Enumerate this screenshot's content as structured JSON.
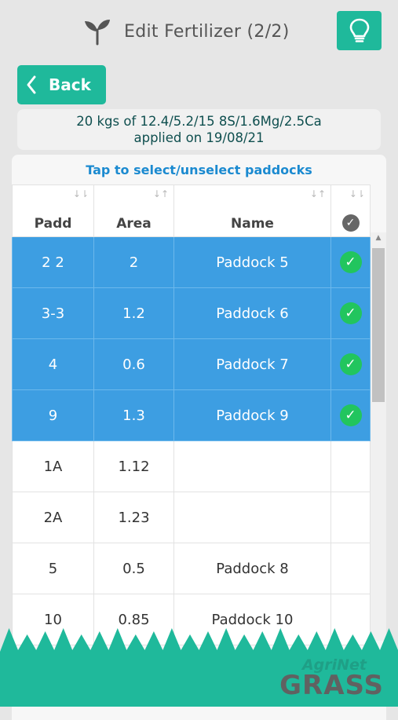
{
  "header": {
    "title": "Edit Fertilizer (2/2)",
    "icon": "sprout-icon",
    "action_icon": "lightbulb-icon"
  },
  "back": {
    "label": "Back"
  },
  "info": {
    "line1": "20 kgs of 12.4/5.2/15 8S/1.6Mg/2.5Ca",
    "line2": "applied on 19/08/21"
  },
  "instruction": "Tap to select/unselect paddocks",
  "table": {
    "headers": {
      "padd": "Padd",
      "area": "Area",
      "name": "Name"
    },
    "rows": [
      {
        "padd": "2 2",
        "area": "2",
        "name": "Paddock 5",
        "selected": true
      },
      {
        "padd": "3-3",
        "area": "1.2",
        "name": "Paddock 6",
        "selected": true
      },
      {
        "padd": "4",
        "area": "0.6",
        "name": "Paddock 7",
        "selected": true
      },
      {
        "padd": "9",
        "area": "1.3",
        "name": "Paddock 9",
        "selected": true
      },
      {
        "padd": "1A",
        "area": "1.12",
        "name": "",
        "selected": false
      },
      {
        "padd": "2A",
        "area": "1.23",
        "name": "",
        "selected": false
      },
      {
        "padd": "5",
        "area": "0.5",
        "name": "Paddock 8",
        "selected": false
      },
      {
        "padd": "10",
        "area": "0.85",
        "name": "Paddock 10",
        "selected": false
      }
    ]
  },
  "logo": {
    "top": "AgriNet",
    "bottom": "GRASS"
  },
  "colors": {
    "accent": "#1fb99b",
    "selected_row": "#3d9ee2",
    "check": "#22c55e",
    "link": "#1b8ad0"
  }
}
